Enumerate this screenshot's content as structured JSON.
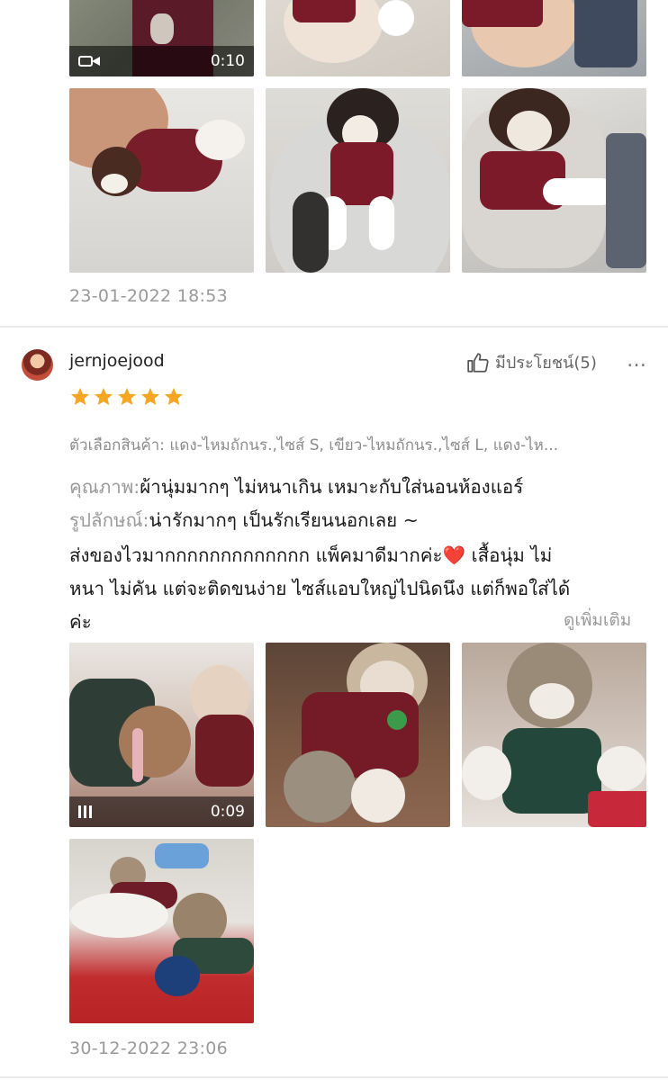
{
  "review1": {
    "video_duration": "0:10",
    "date": "23-01-2022 18:53"
  },
  "review2": {
    "username": "jernjoejood",
    "helpful_label": "มีประโยชน์(5)",
    "more_icon": "…",
    "rating": 5,
    "variant": "ตัวเลือกสินค้า: แดง-ไหมถักนร.,ไซส์ S, เขียว-ไหมถักนร.,ไซส์ L, แดง-ไห...",
    "quality_label": "คุณภาพ:",
    "quality_value": "ผ้านุ่มมากๆ ไม่หนาเกิน เหมาะกับใส่นอนห้องแอร์",
    "appearance_label": "รูปลักษณ์:",
    "appearance_value": "น่ารักมากๆ เป็นรักเรียนนอกเลย ~",
    "body_line1": "ส่งของไวมากกกกกกกกกกกกก แพ็คมาดีมากค่ะ",
    "heart": "❤️",
    "body_line1_after": " เสื้อนุ่ม ไม่",
    "body_line2": "หนา ไม่คัน แต่จะติดขนง่าย ไซส์แอบใหญ่ไปนิดนึง แต่ก็พอใส่ได้",
    "body_line3": "ค่ะ",
    "see_more": "ดูเพิ่มเติม",
    "video_duration": "0:09",
    "date": "30-12-2022 23:06"
  },
  "colors": {
    "star": "#f5a623",
    "muted_text": "#9a9a9a",
    "divider": "#ececec"
  }
}
